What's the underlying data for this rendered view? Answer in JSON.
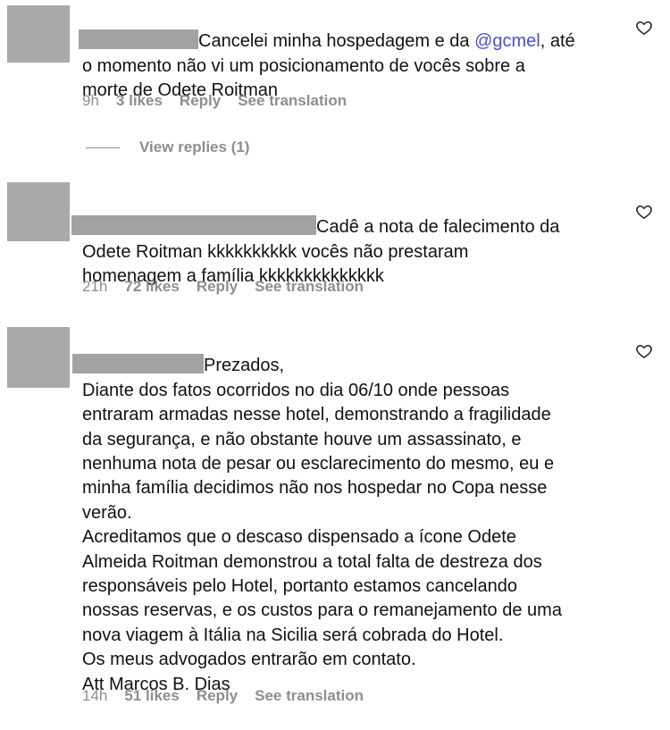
{
  "comments": [
    {
      "text_before_mention": "Cancelei minha hospedagem e da ",
      "mention": "@gcmel",
      "text_after_mention": ", até\no momento não vi um posicionamento de vocês sobre a\nmorte de Odete Roitman",
      "time": "9h",
      "likes": "3 likes",
      "reply": "Reply",
      "translation": "See translation",
      "view_replies": "View replies (1)"
    },
    {
      "text": "Cadê a nota de falecimento da\nOdete Roitman kkkkkkkkkk vocês não prestaram\nhomenagem a família kkkkkkkkkkkkkk",
      "time": "21h",
      "likes": "72 likes",
      "reply": "Reply",
      "translation": "See translation"
    },
    {
      "text": "Prezados,\nDiante dos fatos ocorridos no dia 06/10 onde pessoas\nentraram armadas nesse hotel, demonstrando a fragilidade\nda segurança, e não obstante houve um assassinato, e\nnenhuma nota de pesar ou esclarecimento do mesmo, eu e\nminha família decidimos não nos hospedar no Copa nesse\nverão.\nAcreditamos que o descaso dispensado a ícone Odete\nAlmeida Roitman demonstrou a total falta de destreza dos\nresponsáveis pelo Hotel, portanto estamos cancelando\nnossas reservas, e os custos para o remanejamento de uma\nnova viagem à Itália na Sicilia será cobrada do Hotel.\nOs meus advogados entrarão em contato.\nAtt Marcos B. Dias",
      "time": "14h",
      "likes": "51 likes",
      "reply": "Reply",
      "translation": "See translation"
    }
  ],
  "colors": {
    "meta": "#8e8e8e",
    "mention": "#4a4fc9",
    "redaction": "#a2a2a2",
    "avatar": "#a9a9a9"
  },
  "icons": [
    "heart-outline-icon"
  ]
}
